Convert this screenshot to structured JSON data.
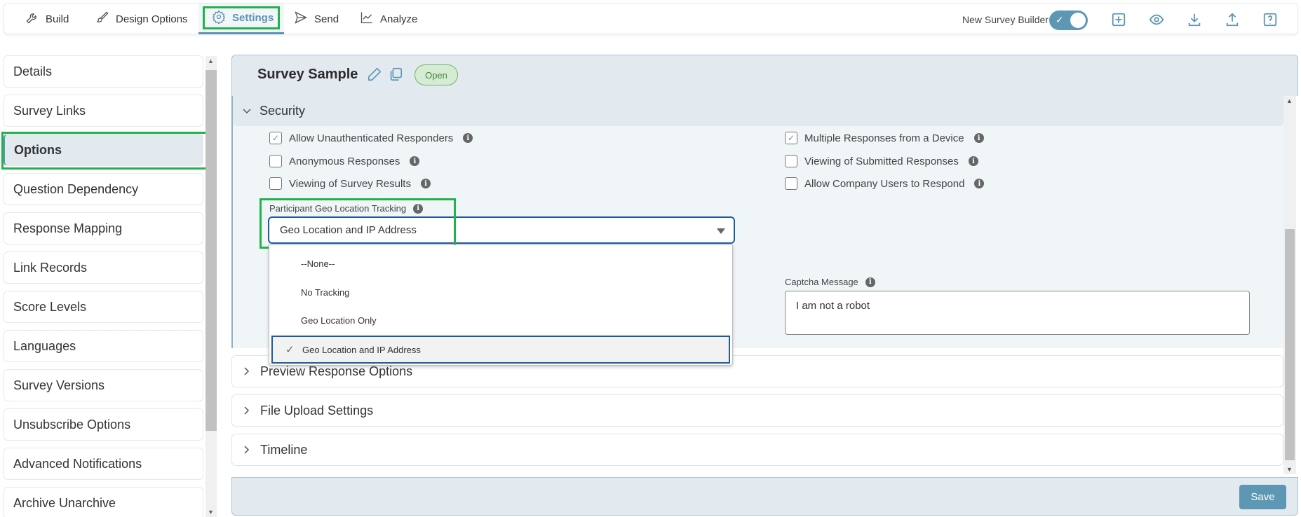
{
  "nav": {
    "tabs": [
      {
        "label": "Build",
        "icon": "wrench-icon"
      },
      {
        "label": "Design Options",
        "icon": "brush-icon"
      },
      {
        "label": "Settings",
        "icon": "gear-icon",
        "active": true
      },
      {
        "label": "Send",
        "icon": "send-icon"
      },
      {
        "label": "Analyze",
        "icon": "chart-icon"
      }
    ],
    "new_builder_label": "New Survey Builder",
    "new_builder_enabled": true,
    "tools": [
      "add-icon",
      "preview-eye-icon",
      "download-icon",
      "upload-icon",
      "help-icon"
    ]
  },
  "sidebar": {
    "items": [
      {
        "label": "Details"
      },
      {
        "label": "Survey Links"
      },
      {
        "label": "Options",
        "active": true
      },
      {
        "label": "Question Dependency"
      },
      {
        "label": "Response Mapping"
      },
      {
        "label": "Link Records"
      },
      {
        "label": "Score Levels"
      },
      {
        "label": "Languages"
      },
      {
        "label": "Survey Versions"
      },
      {
        "label": "Unsubscribe Options"
      },
      {
        "label": "Advanced Notifications"
      },
      {
        "label": "Archive Unarchive"
      }
    ]
  },
  "header": {
    "title": "Survey Sample",
    "status": "Open"
  },
  "security": {
    "title": "Security",
    "left_options": [
      {
        "label": "Allow Unauthenticated Responders",
        "checked": true
      },
      {
        "label": "Anonymous Responses",
        "checked": false
      },
      {
        "label": "Viewing of Survey Results",
        "checked": false
      }
    ],
    "right_options": [
      {
        "label": "Multiple Responses from a Device",
        "checked": true
      },
      {
        "label": "Viewing of Submitted Responses",
        "checked": false
      },
      {
        "label": "Allow Company Users to Respond",
        "checked": false
      }
    ],
    "geo_label": "Participant Geo Location Tracking",
    "geo_value": "Geo Location and IP Address",
    "geo_options": [
      "--None--",
      "No Tracking",
      "Geo Location Only",
      "Geo Location and IP Address"
    ],
    "captcha_label": "Captcha Message",
    "captcha_value": "I am not a robot"
  },
  "sections": [
    {
      "title": "Preview Response Options"
    },
    {
      "title": "File Upload Settings"
    },
    {
      "title": "Timeline"
    }
  ],
  "footer": {
    "save_label": "Save"
  },
  "check_glyph": "✓",
  "info_glyph": "i"
}
